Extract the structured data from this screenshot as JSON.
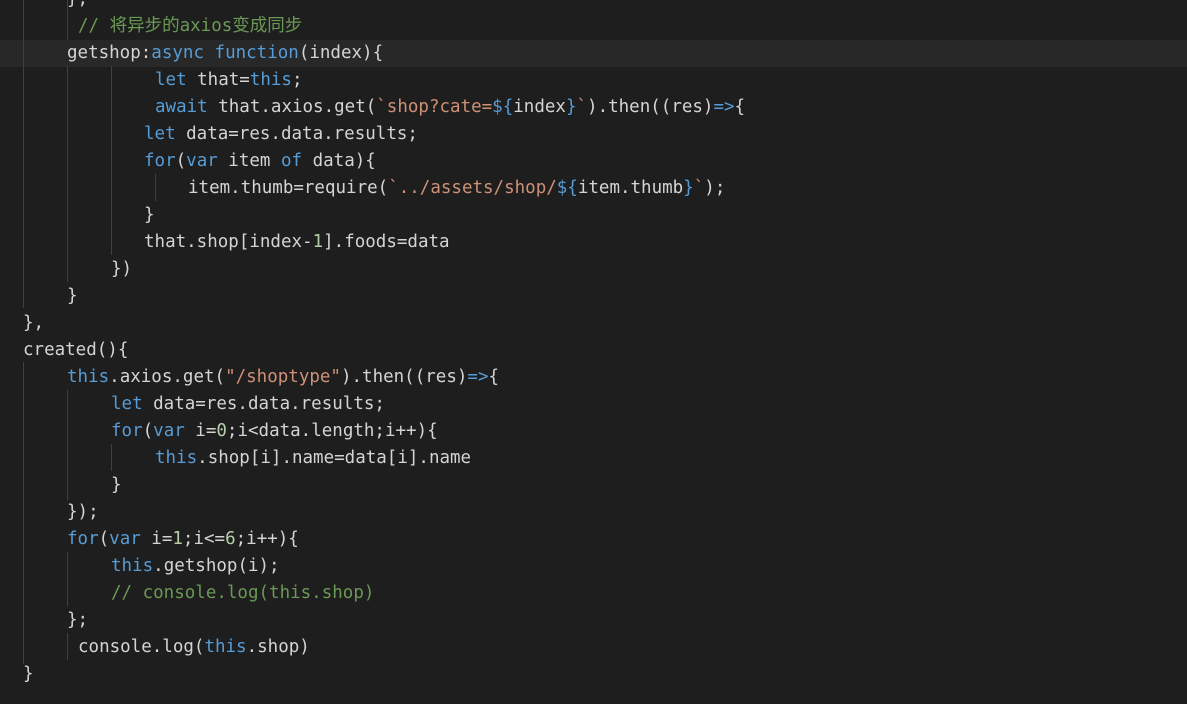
{
  "editor": {
    "theme": {
      "background": "#1e1e1e",
      "text": "#d4d4d4",
      "keyword": "#569cd6",
      "string": "#ce9178",
      "number": "#b5cea8",
      "comment": "#6a9955"
    },
    "lines": [
      [
        {
          "t": "},"
        }
      ],
      [
        {
          "t": "// 将异步的axios变成同步",
          "c": "cmt"
        }
      ],
      [
        {
          "t": "getshop:"
        },
        {
          "t": "async",
          "c": "kw"
        },
        {
          "t": " "
        },
        {
          "t": "function",
          "c": "kw"
        },
        {
          "t": "(index){"
        }
      ],
      [
        {
          "t": "let",
          "c": "kw"
        },
        {
          "t": " that="
        },
        {
          "t": "this",
          "c": "kw"
        },
        {
          "t": ";"
        }
      ],
      [
        {
          "t": "await",
          "c": "kw"
        },
        {
          "t": " that.axios.get("
        },
        {
          "t": "`shop?cate=",
          "c": "str"
        },
        {
          "t": "${",
          "c": "kw"
        },
        {
          "t": "index"
        },
        {
          "t": "}",
          "c": "kw"
        },
        {
          "t": "`",
          "c": "str"
        },
        {
          "t": ").then((res)"
        },
        {
          "t": "=>",
          "c": "kw"
        },
        {
          "t": "{"
        }
      ],
      [
        {
          "t": "let",
          "c": "kw"
        },
        {
          "t": " data=res.data.results;"
        }
      ],
      [
        {
          "t": "for",
          "c": "kw"
        },
        {
          "t": "("
        },
        {
          "t": "var",
          "c": "kw"
        },
        {
          "t": " item "
        },
        {
          "t": "of",
          "c": "kw"
        },
        {
          "t": " data){"
        }
      ],
      [
        {
          "t": "item.thumb=require("
        },
        {
          "t": "`../assets/shop/",
          "c": "str"
        },
        {
          "t": "${",
          "c": "kw"
        },
        {
          "t": "item.thumb"
        },
        {
          "t": "}",
          "c": "kw"
        },
        {
          "t": "`",
          "c": "str"
        },
        {
          "t": ");"
        }
      ],
      [
        {
          "t": "}"
        }
      ],
      [
        {
          "t": "that.shop[index-"
        },
        {
          "t": "1",
          "c": "num"
        },
        {
          "t": "].foods=data"
        }
      ],
      [
        {
          "t": "})"
        }
      ],
      [
        {
          "t": "}"
        }
      ],
      [
        {
          "t": "},"
        }
      ],
      [
        {
          "t": "created(){"
        }
      ],
      [
        {
          "t": "this",
          "c": "kw"
        },
        {
          "t": ".axios.get("
        },
        {
          "t": "\"/shoptype\"",
          "c": "str"
        },
        {
          "t": ").then((res)"
        },
        {
          "t": "=>",
          "c": "kw"
        },
        {
          "t": "{"
        }
      ],
      [
        {
          "t": "let",
          "c": "kw"
        },
        {
          "t": " data=res.data.results;"
        }
      ],
      [
        {
          "t": "for",
          "c": "kw"
        },
        {
          "t": "("
        },
        {
          "t": "var",
          "c": "kw"
        },
        {
          "t": " i="
        },
        {
          "t": "0",
          "c": "num"
        },
        {
          "t": ";i<data.length;i++){"
        }
      ],
      [
        {
          "t": "this",
          "c": "kw"
        },
        {
          "t": ".shop[i].name=data[i].name"
        }
      ],
      [
        {
          "t": "}"
        }
      ],
      [
        {
          "t": "});"
        }
      ],
      [
        {
          "t": "for",
          "c": "kw"
        },
        {
          "t": "("
        },
        {
          "t": "var",
          "c": "kw"
        },
        {
          "t": " i="
        },
        {
          "t": "1",
          "c": "num"
        },
        {
          "t": ";i<="
        },
        {
          "t": "6",
          "c": "num"
        },
        {
          "t": ";i++){"
        }
      ],
      [
        {
          "t": "this",
          "c": "kw"
        },
        {
          "t": ".getshop(i);"
        }
      ],
      [
        {
          "t": "// console.log(this.shop)",
          "c": "cmt"
        }
      ],
      [
        {
          "t": "};"
        }
      ],
      [
        {
          "t": "console.log("
        },
        {
          "t": "this",
          "c": "kw"
        },
        {
          "t": ".shop)"
        }
      ],
      [
        {
          "t": "}"
        }
      ]
    ]
  }
}
